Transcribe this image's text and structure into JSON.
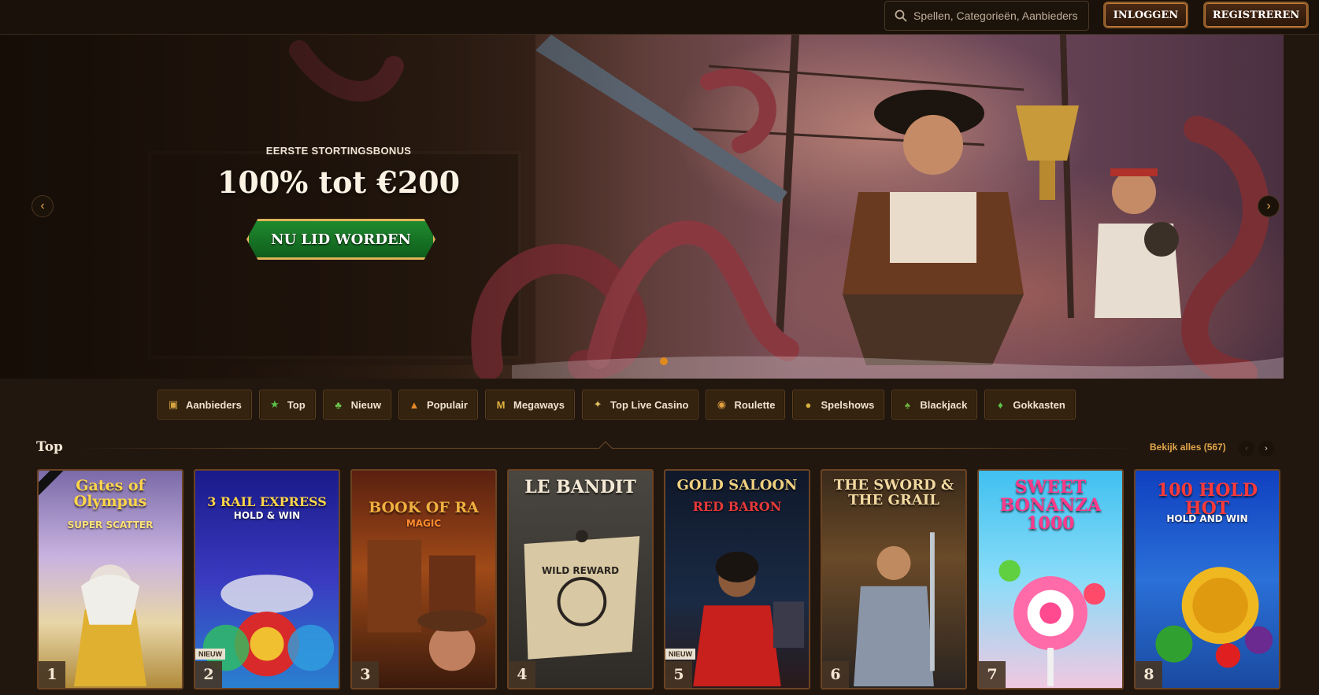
{
  "header": {
    "search_placeholder": "Spellen, Categorieën, Aanbieders",
    "login_label": "INLOGGEN",
    "register_label": "REGISTREREN"
  },
  "hero": {
    "subtitle": "EERSTE STORTINGSBONUS",
    "title": "100% tot €200",
    "cta_label": "NU LID WORDEN",
    "prev_icon": "chevron-left-icon",
    "next_icon": "chevron-right-icon"
  },
  "categories": [
    {
      "label": "Aanbieders",
      "icon": "providers-icon"
    },
    {
      "label": "Top",
      "icon": "star-icon"
    },
    {
      "label": "Nieuw",
      "icon": "new-icon"
    },
    {
      "label": "Populair",
      "icon": "fire-icon"
    },
    {
      "label": "Megaways",
      "icon": "megaways-icon"
    },
    {
      "label": "Top Live Casino",
      "icon": "live-casino-icon"
    },
    {
      "label": "Roulette",
      "icon": "roulette-icon"
    },
    {
      "label": "Spelshows",
      "icon": "gameshow-icon"
    },
    {
      "label": "Blackjack",
      "icon": "cards-icon"
    },
    {
      "label": "Gokkasten",
      "icon": "slot-icon"
    }
  ],
  "section": {
    "title": "Top",
    "see_all_label": "Bekijk alles (567)"
  },
  "games": [
    {
      "rank": "1",
      "title": "Gates of Olympus",
      "subtitle": "SUPER SCATTER",
      "new": ""
    },
    {
      "rank": "2",
      "title": "3 RAIL EXPRESS",
      "subtitle": "HOLD & WIN",
      "new": "NIEUW"
    },
    {
      "rank": "3",
      "title": "BOOK OF RA",
      "subtitle": "MAGIC",
      "new": ""
    },
    {
      "rank": "4",
      "title": "LE BANDIT",
      "subtitle": "WILD REWARD",
      "new": ""
    },
    {
      "rank": "5",
      "title": "GOLD SALOON",
      "subtitle": "RED BARON",
      "new": "NIEUW"
    },
    {
      "rank": "6",
      "title": "THE SWORD & THE GRAIL",
      "subtitle": "",
      "new": ""
    },
    {
      "rank": "7",
      "title": "SWEET BONANZA 1000",
      "subtitle": "",
      "new": ""
    },
    {
      "rank": "8",
      "title": "100 HOLD HOT",
      "subtitle": "HOLD AND WIN",
      "new": ""
    }
  ],
  "colors": {
    "background": "#22170f",
    "accent": "#e0a64a",
    "cta_green": "#1f8a2e",
    "card_border": "#6b4322"
  }
}
